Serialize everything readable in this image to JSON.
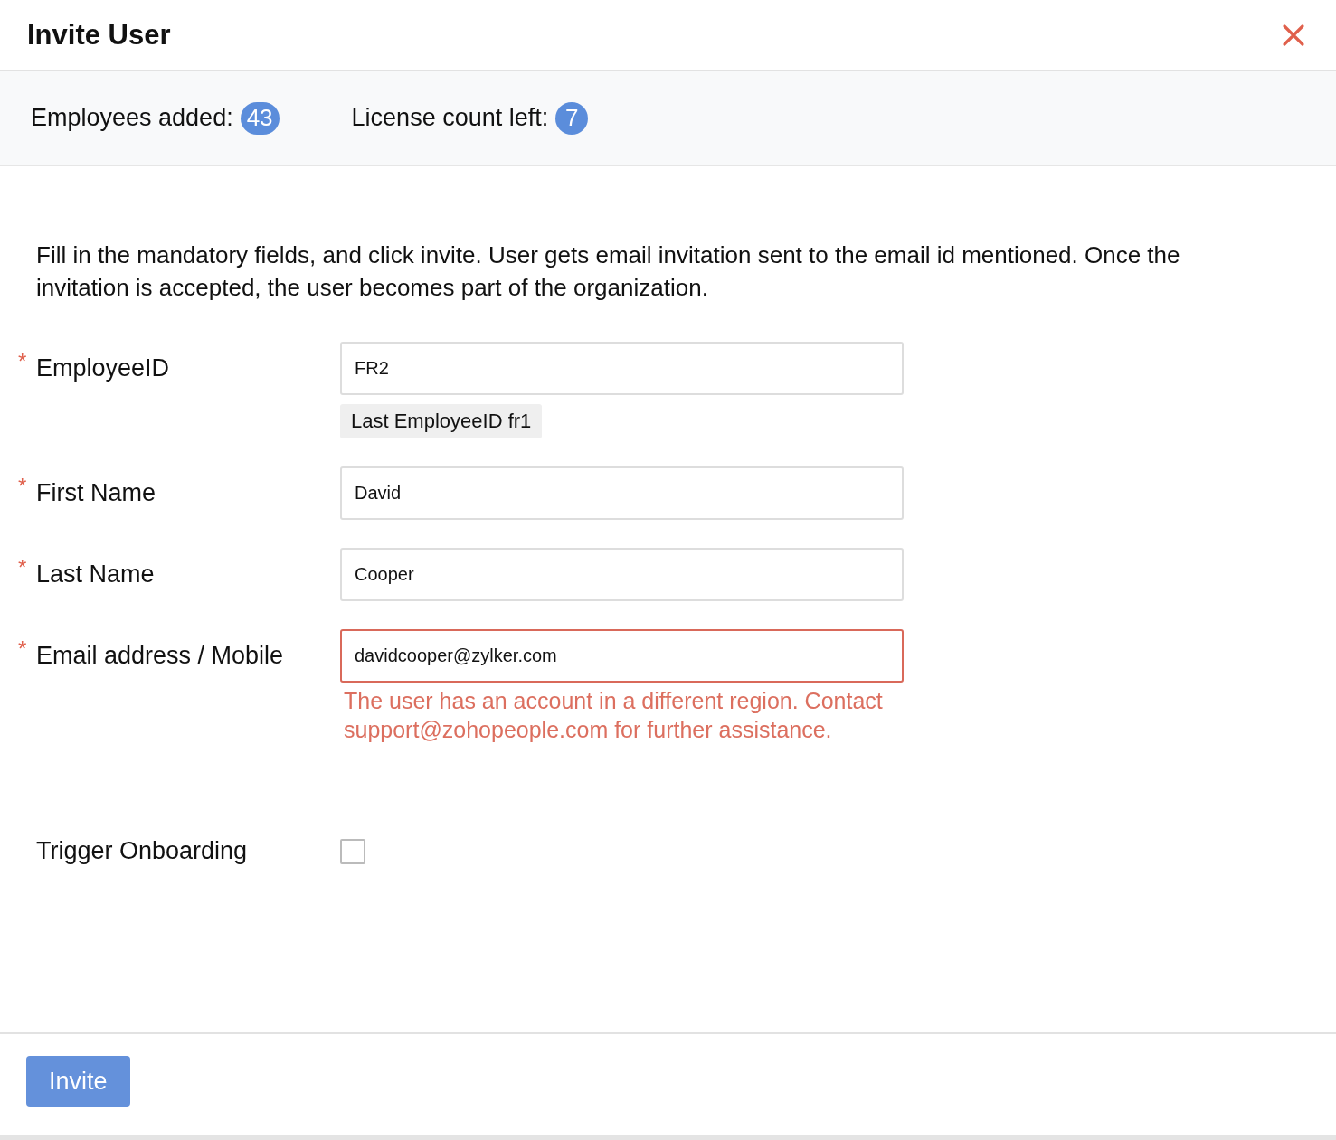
{
  "dialog": {
    "title": "Invite User"
  },
  "stats": [
    {
      "label": "Employees added:",
      "count": "43"
    },
    {
      "label": "License count left:",
      "count": "7"
    }
  ],
  "description": "Fill in the mandatory fields, and click invite. User gets email invitation sent to the email id mentioned. Once the invitation is accepted, the user becomes part of the organization.",
  "fields": [
    {
      "kind": "text",
      "label": "EmployeeID",
      "required_mark": "*",
      "value": "FR2",
      "hint": "Last EmployeeID fr1"
    },
    {
      "kind": "text",
      "label": "First Name",
      "required_mark": "*",
      "value": "David"
    },
    {
      "kind": "text",
      "label": "Last Name",
      "required_mark": "*",
      "value": "Cooper"
    },
    {
      "kind": "text",
      "label": "Email address / Mobile",
      "required_mark": "*",
      "value": "davidcooper@zylker.com",
      "error": "The user has an account in a different region. Contact support@zohopeople.com for further assistance."
    },
    {
      "kind": "checkbox",
      "label": "Trigger Onboarding",
      "checked": false
    }
  ],
  "buttons": [
    {
      "label": "Invite"
    }
  ]
}
